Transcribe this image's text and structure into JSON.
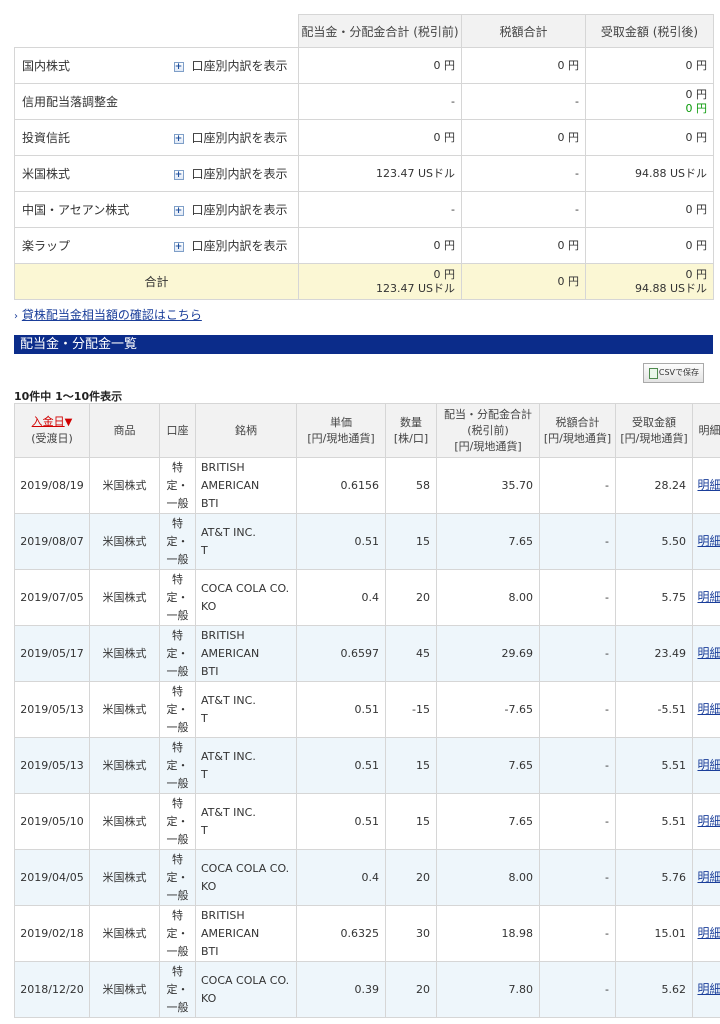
{
  "summary": {
    "headers": [
      "配当金・分配金合計 (税引前)",
      "税額合計",
      "受取金額 (税引後)"
    ],
    "breakdown_label": "口座別内訳を表示",
    "rows": [
      {
        "name": "国内株式",
        "has_breakdown": true,
        "pre_tax": [
          "0 円"
        ],
        "tax": [
          "0 円"
        ],
        "after_tax": [
          "0 円"
        ]
      },
      {
        "name": "信用配当落調整金",
        "has_breakdown": false,
        "pre_tax": [
          "-"
        ],
        "tax": [
          "-"
        ],
        "after_tax": [
          "0 円",
          "0 円"
        ],
        "after_tax_green_line": 1
      },
      {
        "name": "投資信託",
        "has_breakdown": true,
        "pre_tax": [
          "0 円"
        ],
        "tax": [
          "0 円"
        ],
        "after_tax": [
          "0 円"
        ]
      },
      {
        "name": "米国株式",
        "has_breakdown": true,
        "pre_tax": [
          "123.47 USドル"
        ],
        "tax": [
          "-"
        ],
        "after_tax": [
          "94.88 USドル"
        ]
      },
      {
        "name": "中国・アセアン株式",
        "has_breakdown": true,
        "pre_tax": [
          "-"
        ],
        "tax": [
          "-"
        ],
        "after_tax": [
          "0 円"
        ]
      },
      {
        "name": "楽ラップ",
        "has_breakdown": true,
        "pre_tax": [
          "0 円"
        ],
        "tax": [
          "0 円"
        ],
        "after_tax": [
          "0 円"
        ]
      }
    ],
    "total": {
      "label": "合計",
      "pre_tax": [
        "0 円",
        "123.47 USドル"
      ],
      "tax": [
        "0 円"
      ],
      "after_tax": [
        "0 円",
        "94.88 USドル"
      ]
    }
  },
  "lend_link": {
    "arrow": "›",
    "label": "貸株配当金相当額の確認はこちら"
  },
  "section_title": "配当金・分配金一覧",
  "csv_button": "CSVで保存",
  "count_text": "10件中 1〜10件表示",
  "list": {
    "headers": {
      "date": "入金日",
      "date_sort_arrow": "▼",
      "date_sub": "(受渡日)",
      "product": "商品",
      "account": "口座",
      "issue": "銘柄",
      "unit_price": [
        "単価",
        "[円/現地通貨]"
      ],
      "quantity": [
        "数量",
        "[株/口]"
      ],
      "dividend": [
        "配当・分配金合計",
        "(税引前)",
        "[円/現地通貨]"
      ],
      "tax": [
        "税額合計",
        "[円/現地通貨]"
      ],
      "received": [
        "受取金額",
        "[円/現地通貨]"
      ],
      "detail": "明細"
    },
    "account_lines": [
      "特",
      "定",
      "・",
      "一般"
    ],
    "detail_link": "明細",
    "rows": [
      {
        "date": "2019/08/19",
        "product": "米国株式",
        "issue": [
          "BRITISH",
          "AMERICAN",
          "BTI"
        ],
        "unit_price": "0.6156",
        "quantity": "58",
        "dividend": "35.70",
        "tax": "-",
        "received": "28.24"
      },
      {
        "date": "2019/08/07",
        "product": "米国株式",
        "issue": [
          "AT&T INC.",
          "T"
        ],
        "unit_price": "0.51",
        "quantity": "15",
        "dividend": "7.65",
        "tax": "-",
        "received": "5.50"
      },
      {
        "date": "2019/07/05",
        "product": "米国株式",
        "issue": [
          "COCA COLA CO.",
          "KO"
        ],
        "unit_price": "0.4",
        "quantity": "20",
        "dividend": "8.00",
        "tax": "-",
        "received": "5.75"
      },
      {
        "date": "2019/05/17",
        "product": "米国株式",
        "issue": [
          "BRITISH",
          "AMERICAN",
          "BTI"
        ],
        "unit_price": "0.6597",
        "quantity": "45",
        "dividend": "29.69",
        "tax": "-",
        "received": "23.49"
      },
      {
        "date": "2019/05/13",
        "product": "米国株式",
        "issue": [
          "AT&T INC.",
          "T"
        ],
        "unit_price": "0.51",
        "quantity": "-15",
        "dividend": "-7.65",
        "tax": "-",
        "received": "-5.51"
      },
      {
        "date": "2019/05/13",
        "product": "米国株式",
        "issue": [
          "AT&T INC.",
          "T"
        ],
        "unit_price": "0.51",
        "quantity": "15",
        "dividend": "7.65",
        "tax": "-",
        "received": "5.51"
      },
      {
        "date": "2019/05/10",
        "product": "米国株式",
        "issue": [
          "AT&T INC.",
          "T"
        ],
        "unit_price": "0.51",
        "quantity": "15",
        "dividend": "7.65",
        "tax": "-",
        "received": "5.51"
      },
      {
        "date": "2019/04/05",
        "product": "米国株式",
        "issue": [
          "COCA COLA CO.",
          "KO"
        ],
        "unit_price": "0.4",
        "quantity": "20",
        "dividend": "8.00",
        "tax": "-",
        "received": "5.76"
      },
      {
        "date": "2019/02/18",
        "product": "米国株式",
        "issue": [
          "BRITISH",
          "AMERICAN",
          "BTI"
        ],
        "unit_price": "0.6325",
        "quantity": "30",
        "dividend": "18.98",
        "tax": "-",
        "received": "15.01"
      },
      {
        "date": "2018/12/20",
        "product": "米国株式",
        "issue": [
          "COCA COLA CO.",
          "KO"
        ],
        "unit_price": "0.39",
        "quantity": "20",
        "dividend": "7.80",
        "tax": "-",
        "received": "5.62"
      }
    ]
  }
}
